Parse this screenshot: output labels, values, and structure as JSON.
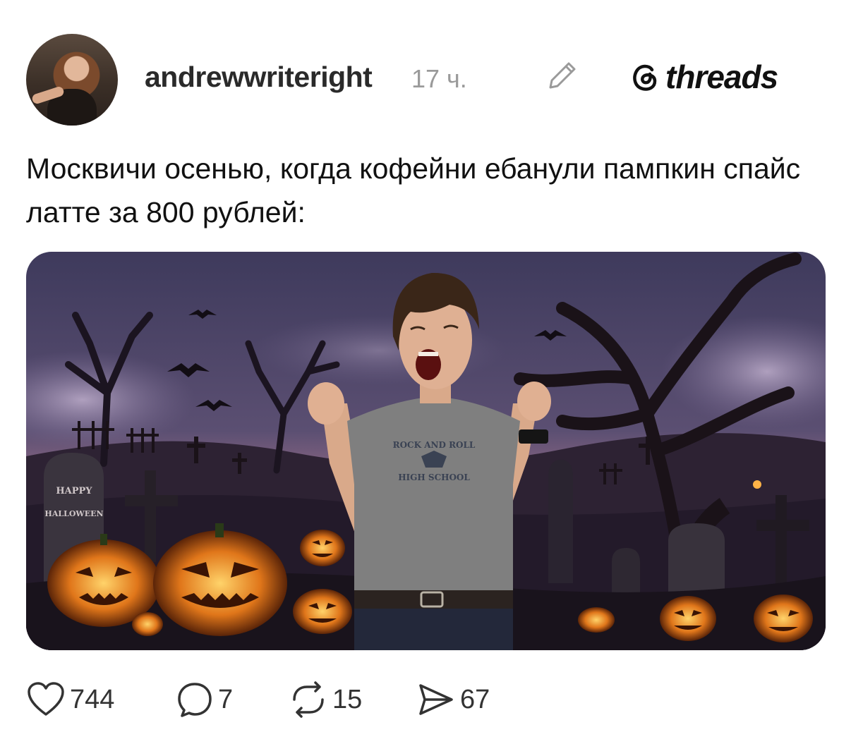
{
  "post": {
    "username": "andrewwriteright",
    "time": "17 ч.",
    "brand": "threads",
    "caption": "Москвичи осенью, когда кофейни ебанули пампкин спайс латте за 800 рублей:"
  },
  "image": {
    "tombstone_text_line1": "HAPPY",
    "tombstone_text_line2": "HALLOWEEN",
    "shirt_text_line1": "ROCK AND ROLL",
    "shirt_text_line2": "HIGH SCHOOL"
  },
  "actions": {
    "likes": "744",
    "comments": "7",
    "reposts": "15",
    "shares": "67"
  },
  "icons": {
    "edit": "pencil-icon",
    "brand": "threads-logo-icon",
    "like": "heart-icon",
    "comment": "speech-bubble-icon",
    "repost": "repost-arrows-icon",
    "share": "send-arrow-icon"
  }
}
